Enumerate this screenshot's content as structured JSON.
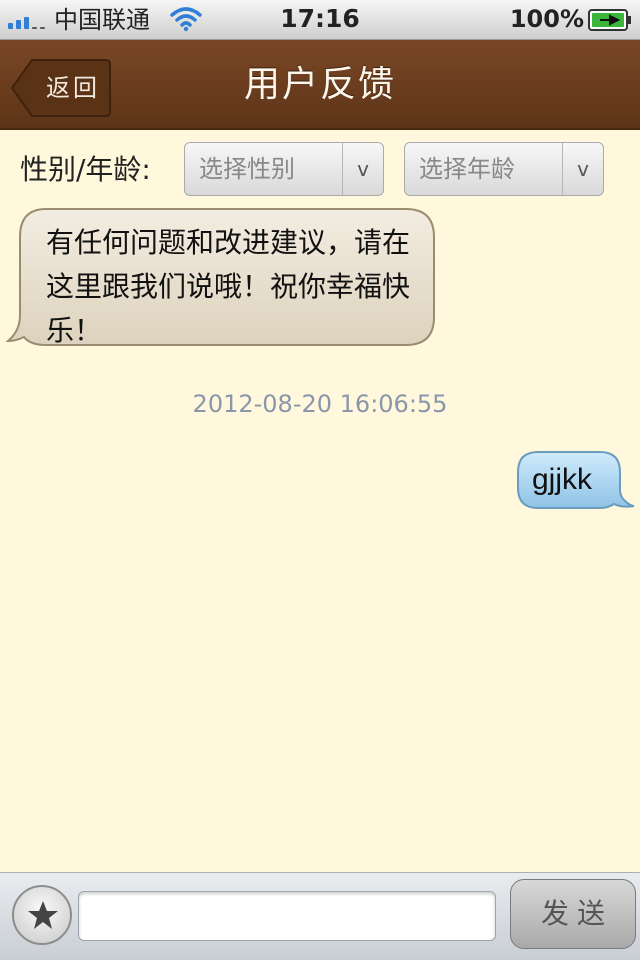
{
  "status_bar": {
    "carrier": "中国联通",
    "time": "17:16",
    "battery_percent": "100%",
    "signal_icon": "signal-bars-icon",
    "wifi_icon": "wifi-icon",
    "battery_icon": "battery-charging-icon"
  },
  "nav": {
    "back_label": "返回",
    "title": "用户反馈",
    "background_color": "#6b3b1c"
  },
  "filter": {
    "label": "性别/年龄:",
    "gender_select": {
      "value": "选择性别",
      "arrow": "v"
    },
    "age_select": {
      "value": "选择年龄",
      "arrow": "v"
    }
  },
  "messages": [
    {
      "side": "left",
      "text": "有任何问题和改进建议，请在这里跟我们说哦！祝你幸福快乐！"
    },
    {
      "side": "timestamp",
      "text": "2012-08-20 16:06:55"
    },
    {
      "side": "right",
      "text": "gjjkk"
    }
  ],
  "input_bar": {
    "favorite_icon": "star-icon",
    "input_value": "",
    "input_placeholder": "",
    "send_label": "发送"
  },
  "colors": {
    "chat_background": "#fff8dc",
    "left_bubble": "#e6dccb",
    "right_bubble": "#a9d3ee",
    "timestamp": "#8a97ab"
  }
}
